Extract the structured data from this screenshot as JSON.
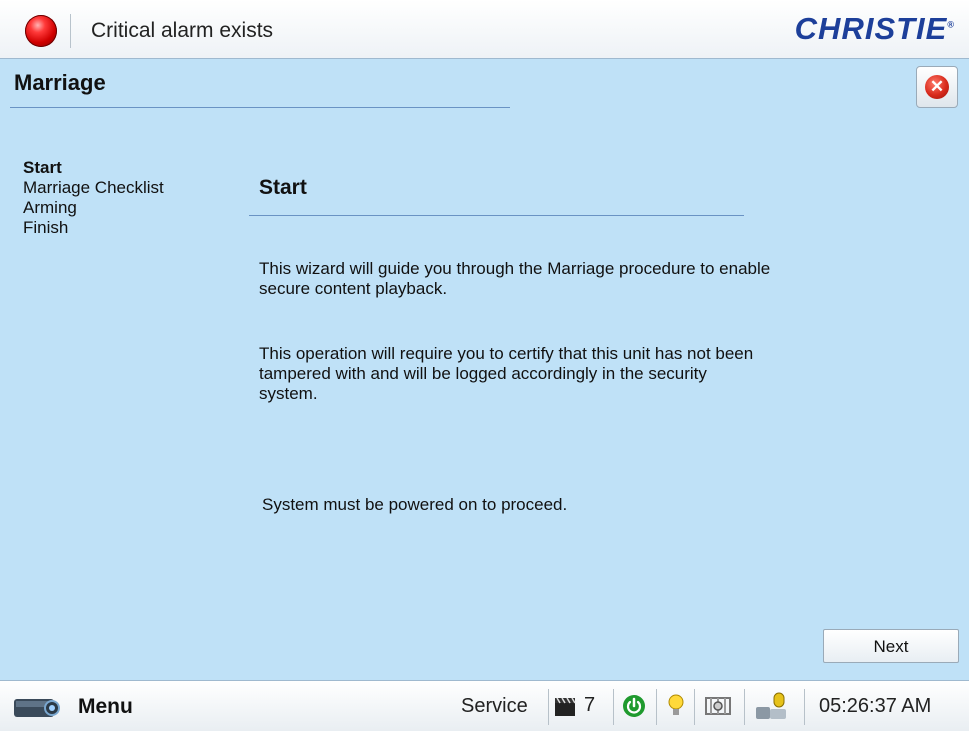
{
  "header": {
    "alarm_text": "Critical alarm exists",
    "logo_text": "CHRISTIE",
    "logo_mark": "®"
  },
  "page": {
    "title": "Marriage",
    "close_icon": "close-icon"
  },
  "steps": [
    {
      "label": "Start",
      "active": true
    },
    {
      "label": "Marriage Checklist",
      "active": false
    },
    {
      "label": "Arming",
      "active": false
    },
    {
      "label": "Finish",
      "active": false
    }
  ],
  "content": {
    "section_title": "Start",
    "paragraph1": "This wizard will guide you through the Marriage procedure to enable secure content playback.",
    "paragraph2": "This operation will require you to certify that this unit has not been tampered with and will be logged accordingly in the security system.",
    "paragraph3": "System must be powered on to proceed."
  },
  "buttons": {
    "next_label": "Next"
  },
  "footer": {
    "menu_label": "Menu",
    "service_label": "Service",
    "channel_count": "7",
    "time": "05:26:37 AM"
  },
  "colors": {
    "background": "#bfe1f7",
    "alarm_red": "#d00000",
    "logo_blue": "#1d3f9a"
  }
}
